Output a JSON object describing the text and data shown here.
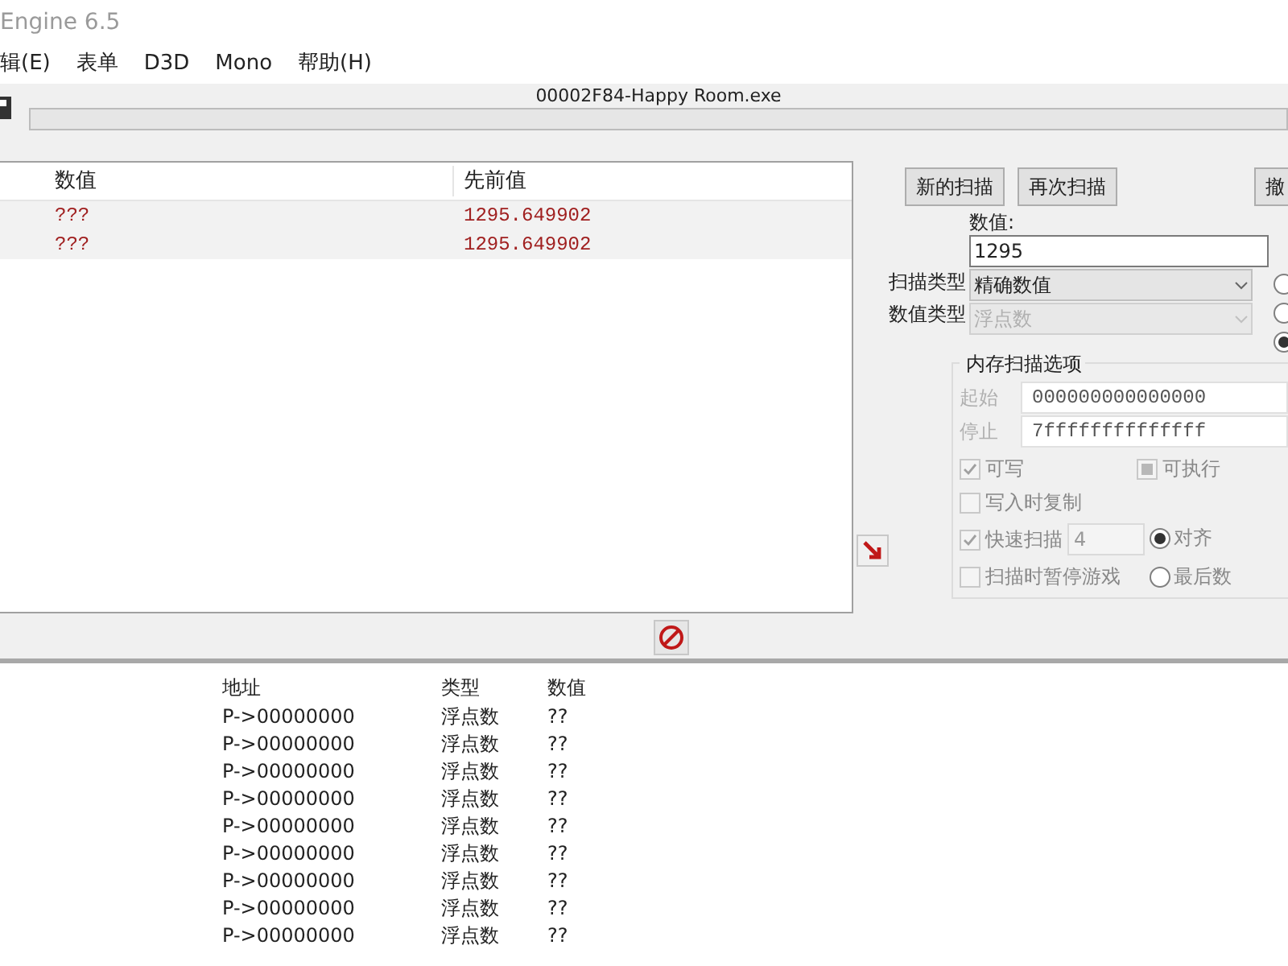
{
  "window": {
    "title": "Engine 6.5"
  },
  "menu": [
    {
      "label": "辑(E)"
    },
    {
      "label": "表单"
    },
    {
      "label": "D3D"
    },
    {
      "label": "Mono"
    },
    {
      "label": "帮助(H)"
    }
  ],
  "toolbar": {
    "process_title": "00002F84-Happy Room.exe",
    "progress": {
      "level": 0
    }
  },
  "results": {
    "columns": [
      "数值",
      "先前值"
    ],
    "rows": [
      {
        "value": "???",
        "previous": "1295.649902"
      },
      {
        "value": "???",
        "previous": "1295.649902"
      }
    ]
  },
  "scan": {
    "buttons": [
      "新的扫描",
      "再次扫描",
      "撤"
    ],
    "value_label": "数值:",
    "value": "1295",
    "scan_type_label": "扫描类型",
    "scan_type": "精确数值",
    "value_type_label": "数值类型",
    "value_type": "浮点数",
    "value_type_disabled": true,
    "radios": [
      {
        "selected": false
      },
      {
        "selected": false
      },
      {
        "selected": true
      }
    ],
    "memory_options": {
      "title": "内存扫描选项",
      "start_label": "起始",
      "start": "000000000000000",
      "stop_label": "停止",
      "stop": "7ffffffffffffff",
      "writable": {
        "label": "可写",
        "checked": true
      },
      "executable": {
        "label": "可执行",
        "indeterminate": true
      },
      "copy_on_write": {
        "label": "写入时复制",
        "checked": false
      },
      "fast_scan": {
        "label": "快速扫描",
        "checked": true,
        "value": "4"
      },
      "alignment": [
        {
          "label": "对齐",
          "selected": true
        },
        {
          "label": "最后数",
          "selected": false
        }
      ],
      "pause": {
        "label": "扫描时暂停游戏",
        "checked": false
      }
    }
  },
  "address_list": {
    "columns": [
      "地址",
      "类型",
      "数值"
    ],
    "rows": [
      {
        "address": "P->00000000",
        "type": "浮点数",
        "value": "??"
      },
      {
        "address": "P->00000000",
        "type": "浮点数",
        "value": "??"
      },
      {
        "address": "P->00000000",
        "type": "浮点数",
        "value": "??"
      },
      {
        "address": "P->00000000",
        "type": "浮点数",
        "value": "??"
      },
      {
        "address": "P->00000000",
        "type": "浮点数",
        "value": "??"
      },
      {
        "address": "P->00000000",
        "type": "浮点数",
        "value": "??"
      },
      {
        "address": "P->00000000",
        "type": "浮点数",
        "value": "??"
      },
      {
        "address": "P->00000000",
        "type": "浮点数",
        "value": "??"
      },
      {
        "address": "P->00000000",
        "type": "浮点数",
        "value": "??"
      }
    ]
  }
}
